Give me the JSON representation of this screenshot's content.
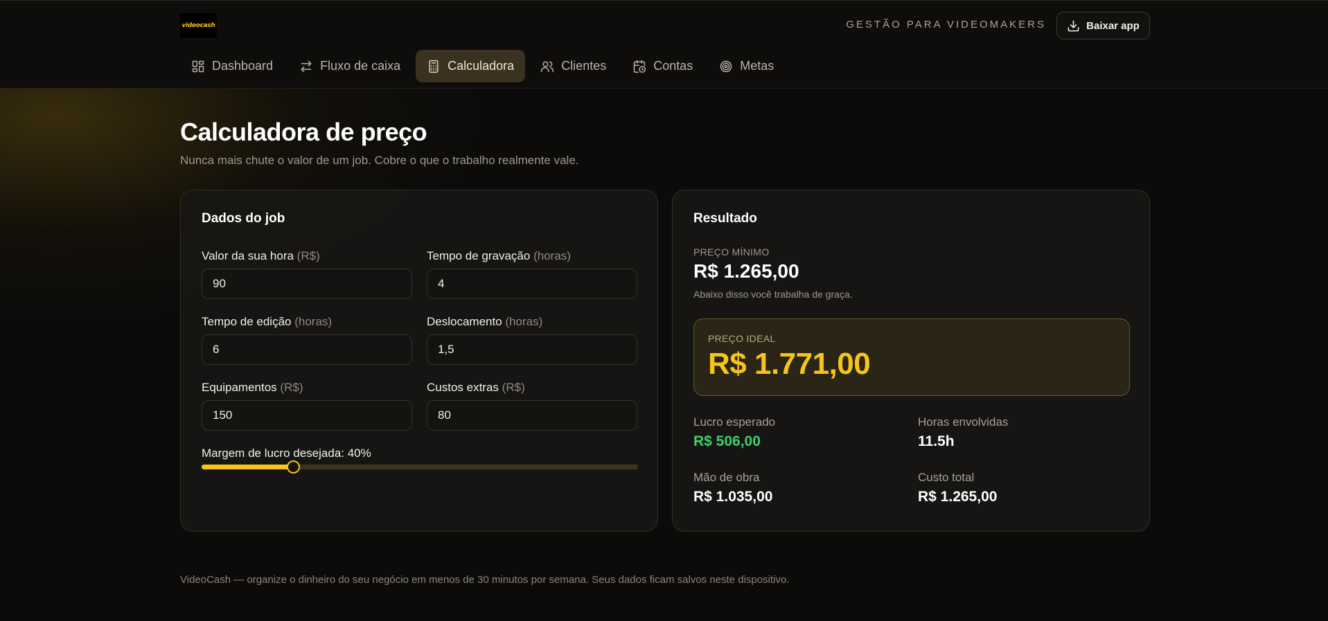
{
  "brand": {
    "logo_text": "videocash",
    "tagline": "GESTÃO PARA VIDEOMAKERS",
    "download_label": "Baixar app",
    "accent": "#f5c518"
  },
  "nav": {
    "items": [
      {
        "label": "Dashboard",
        "icon": "dashboard-icon"
      },
      {
        "label": "Fluxo de caixa",
        "icon": "arrows-exchange-icon"
      },
      {
        "label": "Calculadora",
        "icon": "calculator-icon",
        "active": true
      },
      {
        "label": "Clientes",
        "icon": "users-icon"
      },
      {
        "label": "Contas",
        "icon": "calendar-clock-icon"
      },
      {
        "label": "Metas",
        "icon": "target-icon"
      }
    ]
  },
  "page": {
    "title": "Calculadora de preço",
    "subtitle": "Nunca mais chute o valor de um job. Cobre o que o trabalho realmente vale."
  },
  "job": {
    "title": "Dados do job",
    "fields": [
      {
        "label": "Valor da sua hora",
        "unit": "(R$)",
        "value": "90"
      },
      {
        "label": "Tempo de gravação",
        "unit": "(horas)",
        "value": "4"
      },
      {
        "label": "Tempo de edição",
        "unit": "(horas)",
        "value": "6"
      },
      {
        "label": "Deslocamento",
        "unit": "(horas)",
        "value": "1,5"
      },
      {
        "label": "Equipamentos",
        "unit": "(R$)",
        "value": "150"
      },
      {
        "label": "Custos extras",
        "unit": "(R$)",
        "value": "80"
      }
    ],
    "margin_label": "Margem de lucro desejada: 40%",
    "margin_fraction": 0.21
  },
  "result": {
    "title": "Resultado",
    "min_label": "PREÇO MÍNIMO",
    "min_value": "R$ 1.265,00",
    "min_note": "Abaixo disso você trabalha de graça.",
    "ideal_label": "PREÇO IDEAL",
    "ideal_value": "R$ 1.771,00",
    "stats": [
      {
        "label": "Lucro esperado",
        "value": "R$ 506,00",
        "color": "#3fce6b"
      },
      {
        "label": "Horas envolvidas",
        "value": "11.5h"
      },
      {
        "label": "Mão de obra",
        "value": "R$ 1.035,00"
      },
      {
        "label": "Custo total",
        "value": "R$ 1.265,00"
      }
    ]
  },
  "footer": "VideoCash — organize o dinheiro do seu negócio em menos de 30 minutos por semana. Seus dados ficam salvos neste dispositivo."
}
